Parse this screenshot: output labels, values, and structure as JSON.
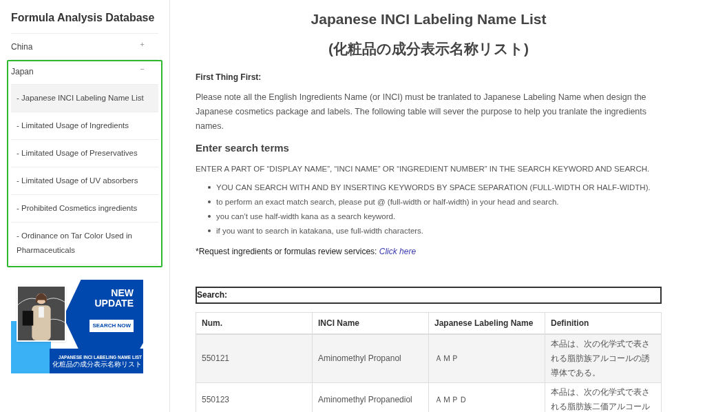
{
  "sidebar": {
    "title": "Formula Analysis Database",
    "groups": [
      {
        "label": "China",
        "expanded": false,
        "highlighted": false
      },
      {
        "label": "Japan",
        "expanded": true,
        "highlighted": true,
        "children": [
          {
            "label": "Japanese INCI Labeling Name List",
            "selected": true
          },
          {
            "label": "Limitated Usage of Ingredients",
            "selected": false
          },
          {
            "label": "Limitated Usage of Preservatives",
            "selected": false
          },
          {
            "label": "Limitated Usage of UV absorbers",
            "selected": false
          },
          {
            "label": "Prohibited Cosmetics ingredients",
            "selected": false
          },
          {
            "label": "Ordinance on Tar Color Used in Pharmaceuticals",
            "selected": false
          }
        ]
      }
    ],
    "item_prefix": "-",
    "banner": {
      "headline": "NEW UPDATE",
      "button": "SEARCH NOW",
      "caption": "JAPANESE INCI LABELING NAME LIST",
      "caption_ja": "化粧品の成分表示名称リスト"
    }
  },
  "main": {
    "title": "Japanese INCI Labeling Name List",
    "subtitle": "(化粧品の成分表示名称リスト)",
    "intro_heading": "First Thing First:",
    "intro": "Please note all the English Ingredients Name (or INCI) must be tranlated to Japanese Labeling Name when design the Japanese cosmetics package and labels. The following table will sever the purpose to help you tranlate the ingredients names.",
    "search_heading": "Enter search terms",
    "search_instruction": "ENTER A PART OF “DISPLAY NAME”, “INCI NAME” OR “INGREDIENT NUMBER” IN THE SEARCH KEYWORD AND SEARCH.",
    "tips": [
      "YOU CAN SEARCH WITH AND BY INSERTING KEYWORDS BY SPACE SEPARATION (FULL-WIDTH OR HALF-WIDTH).",
      "to perform an exact match search, please put @ (full-width or half-width) in your head and search.",
      "you can’t use half-width kana as a search keyword.",
      "if you want to search in katakana, use full-width characters."
    ],
    "request_text": "*Request  ingredients or formulas review services:",
    "request_link": "Click here",
    "search_label": "Search:",
    "table": {
      "columns": [
        "Num.",
        "INCI Name",
        "Japanese Labeling Name",
        "Definition"
      ],
      "rows": [
        {
          "cells": [
            "550121",
            "Aminomethyl Propanol",
            "ＡＭＰ",
            "本品は、次の化学式で表される脂肪族アルコールの誘導体である。"
          ]
        },
        {
          "cells": [
            "550123",
            "Aminomethyl Propanediol",
            "ＡＭＰＤ",
            "本品は、次の化学式で表される脂肪族二価アルコール"
          ]
        }
      ]
    }
  }
}
